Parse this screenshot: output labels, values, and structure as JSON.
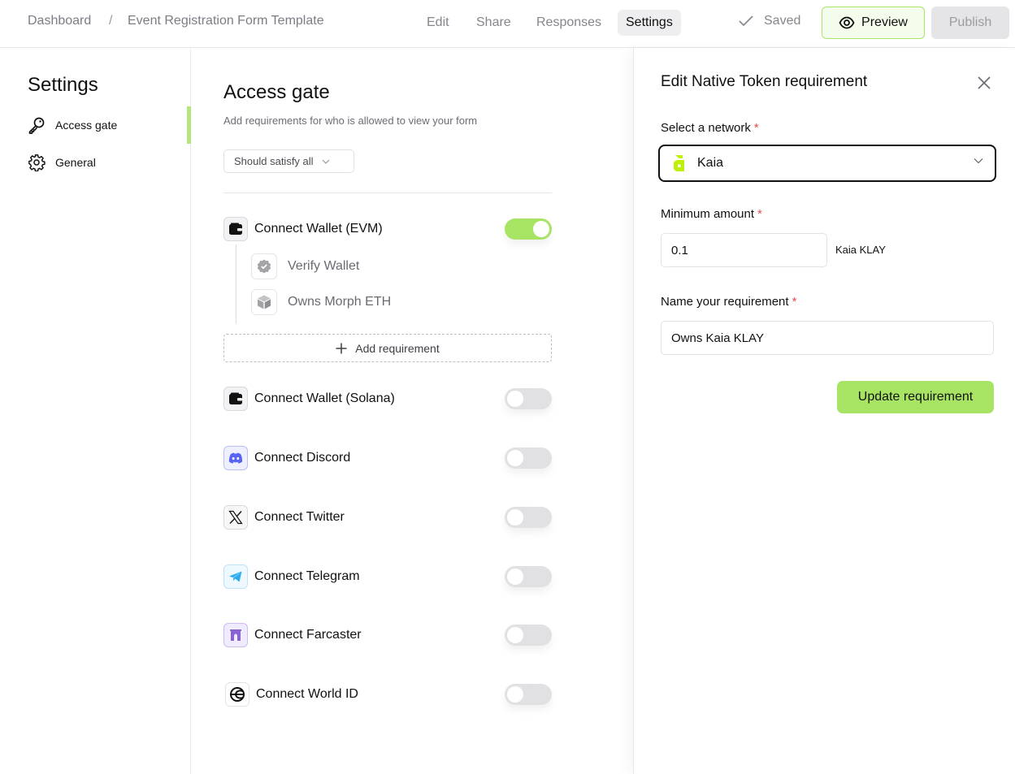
{
  "header": {
    "breadcrumb": [
      "Dashboard",
      "/",
      "Event Registration Form Template"
    ],
    "tabs": [
      {
        "label": "Edit",
        "active": false
      },
      {
        "label": "Share",
        "active": false
      },
      {
        "label": "Responses",
        "active": false
      },
      {
        "label": "Settings",
        "active": true
      }
    ],
    "saved_label": "Saved",
    "preview_label": "Preview",
    "publish_label": "Publish"
  },
  "sidebar": {
    "title": "Settings",
    "items": [
      {
        "label": "Access gate",
        "icon": "key-icon",
        "active": true
      },
      {
        "label": "General",
        "icon": "gear-icon",
        "active": false
      }
    ]
  },
  "main": {
    "title": "Access gate",
    "subtitle": "Add requirements for who is allowed to view your form",
    "satisfy_select": "Should satisfy all",
    "add_requirement_label": "Add requirement",
    "requirements": [
      {
        "label": "Connect Wallet (EVM)",
        "icon": "wallet-icon",
        "enabled": true,
        "sub": [
          {
            "label": "Verify Wallet",
            "icon": "verified-badge-icon"
          },
          {
            "label": "Owns Morph ETH",
            "icon": "cube-icon"
          }
        ]
      },
      {
        "label": "Connect Wallet (Solana)",
        "icon": "wallet-icon",
        "enabled": false
      },
      {
        "label": "Connect Discord",
        "icon": "discord-icon",
        "enabled": false
      },
      {
        "label": "Connect Twitter",
        "icon": "x-twitter-icon",
        "enabled": false
      },
      {
        "label": "Connect Telegram",
        "icon": "telegram-icon",
        "enabled": false
      },
      {
        "label": "Connect Farcaster",
        "icon": "farcaster-icon",
        "enabled": false
      },
      {
        "label": "Connect World ID",
        "icon": "worldcoin-icon",
        "enabled": false
      }
    ]
  },
  "panel": {
    "title": "Edit Native Token requirement",
    "network_label": "Select a network",
    "network_value": "Kaia",
    "amount_label": "Minimum amount",
    "amount_value": "0.1",
    "amount_unit": "Kaia KLAY",
    "name_label": "Name your requirement",
    "name_value": "Owns Kaia KLAY",
    "required_mark": "*",
    "update_label": "Update requirement"
  },
  "colors": {
    "accent": "#a8e463",
    "kaia": "#bff009",
    "discord": "#5865f2",
    "telegram": "#2aabee",
    "farcaster": "#8a63d2",
    "required": "#e5484d"
  }
}
